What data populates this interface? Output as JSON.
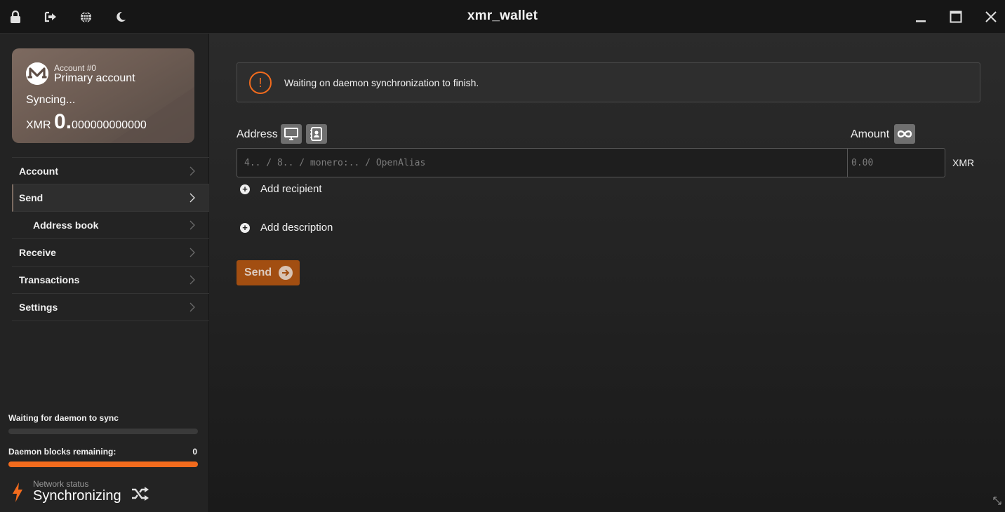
{
  "window": {
    "title": "xmr_wallet",
    "left_icons": [
      "lock-icon",
      "logout-icon",
      "globe-icon",
      "moon-icon"
    ],
    "controls": [
      "minimize-icon",
      "maximize-icon",
      "close-icon"
    ]
  },
  "account_card": {
    "account_number": "Account #0",
    "account_name": "Primary account",
    "sync_text": "Syncing...",
    "currency": "XMR",
    "balance_int": "0.",
    "balance_dec": "000000000000"
  },
  "menu": {
    "account": "Account",
    "send": "Send",
    "address_book": "Address book",
    "receive": "Receive",
    "transactions": "Transactions",
    "settings": "Settings",
    "active": "Send"
  },
  "sync": {
    "waiting_label": "Waiting for daemon to sync",
    "waiting_progress": 0,
    "blocks_label": "Daemon blocks remaining:",
    "blocks_value": "0",
    "blocks_progress": 1
  },
  "network": {
    "label": "Network status",
    "status": "Synchronizing"
  },
  "send_form": {
    "warning": "Waiting on daemon synchronization to finish.",
    "address_label": "Address",
    "address_placeholder": "4.. / 8.. / monero:.. / OpenAlias",
    "amount_label": "Amount",
    "amount_placeholder": "0.00",
    "unit": "XMR",
    "add_recipient": "Add recipient",
    "add_description": "Add description",
    "send_button": "Send"
  },
  "colors": {
    "accent": "#f26b1d",
    "send_button": "#a24e11"
  }
}
